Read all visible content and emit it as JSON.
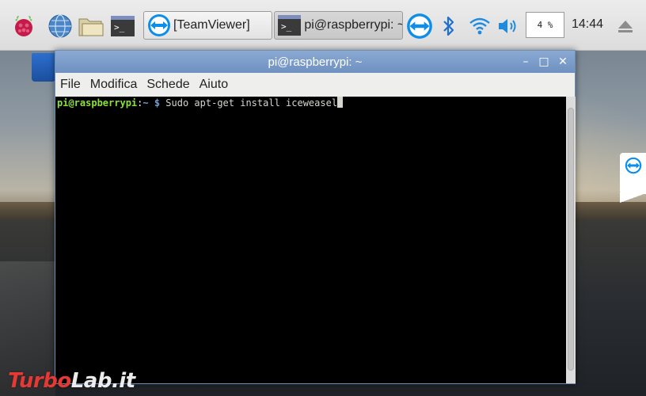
{
  "taskbar": {
    "icons": [
      "raspberry-icon",
      "globe-icon",
      "folder-icon",
      "terminal-icon",
      "teamviewer-icon",
      "bluetooth-icon",
      "wifi-icon",
      "volume-icon",
      "eject-icon"
    ],
    "tasks": [
      {
        "label": "[TeamViewer]"
      },
      {
        "label": "pi@raspberrypi: ~"
      }
    ],
    "terminal_glyph": ">_",
    "cpu_label": "4 %",
    "cpu_value_percent": 4,
    "clock": "14:44"
  },
  "window": {
    "title": "pi@raspberrypi: ~",
    "controls": {
      "minimize": "–",
      "maximize": "□",
      "close": "✕"
    },
    "menu": [
      {
        "label": "File"
      },
      {
        "label": "Modifica"
      },
      {
        "label": "Schede"
      },
      {
        "label": "Aiuto"
      }
    ]
  },
  "terminal": {
    "prompt_user": "pi@raspberrypi",
    "prompt_sep": ":",
    "prompt_path": "~ $",
    "command": " Sudo apt-get install iceweasel"
  },
  "watermark": {
    "part1": "Turbo",
    "part2": "Lab.it"
  },
  "colors": {
    "accent": "#6f91c1",
    "prompt_green": "#8ae234",
    "prompt_blue": "#729fcf",
    "teamviewer_blue": "#0e8ee9"
  }
}
